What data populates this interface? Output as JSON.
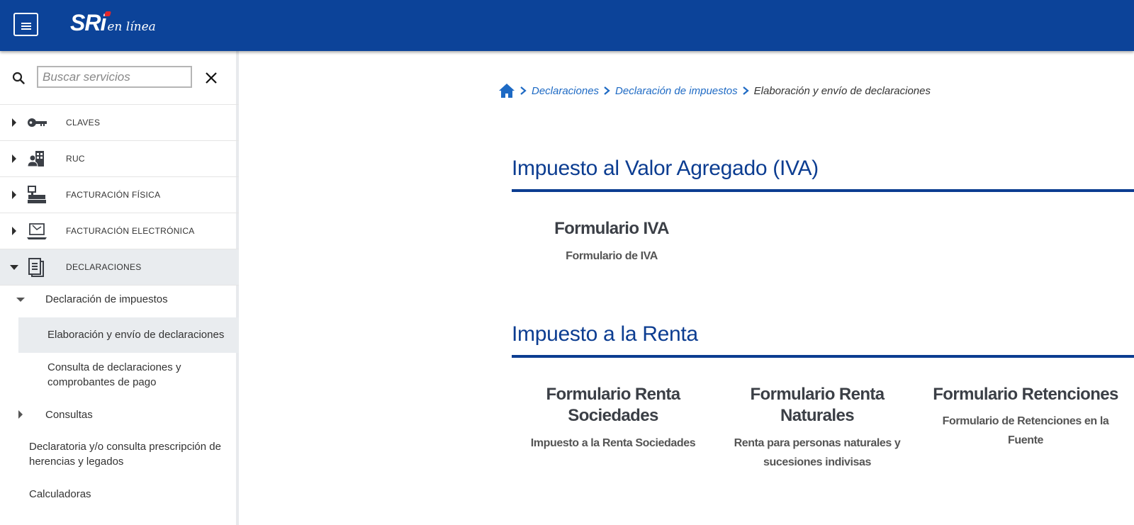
{
  "header": {
    "logo_main": "SRi",
    "logo_sub": "en línea"
  },
  "sidebar": {
    "search_placeholder": "Buscar servicios",
    "items": [
      {
        "label": "CLAVES",
        "icon": "key-icon"
      },
      {
        "label": "RUC",
        "icon": "building-user-icon"
      },
      {
        "label": "FACTURACIÓN FÍSICA",
        "icon": "cash-register-icon"
      },
      {
        "label": "FACTURACIÓN ELECTRÓNICA",
        "icon": "laptop-icon"
      },
      {
        "label": "DECLARACIONES",
        "icon": "document-icon"
      }
    ],
    "sub": {
      "declaracion_impuestos": "Declaración de impuestos",
      "elaboracion": "Elaboración y envío de declaraciones",
      "consulta_line1": "Consulta de declaraciones y",
      "consulta_line2": "comprobantes de pago",
      "consultas": "Consultas",
      "declaratoria_line1": "Declaratoria y/o consulta prescripción de",
      "declaratoria_line2": "herencias y legados",
      "calculadoras": "Calculadoras"
    }
  },
  "breadcrumb": {
    "items": [
      "Declaraciones",
      "Declaración de impuestos"
    ],
    "current": "Elaboración y envío de declaraciones"
  },
  "sections": {
    "iva": {
      "title": "Impuesto al Valor Agregado (IVA)",
      "card": {
        "title": "Formulario IVA",
        "desc": "Formulario de IVA"
      }
    },
    "renta": {
      "title": "Impuesto a la Renta",
      "cards": [
        {
          "title_line1": "Formulario Renta",
          "title_line2": "Sociedades",
          "desc_line1": "Impuesto a la Renta Sociedades",
          "desc_line2": ""
        },
        {
          "title_line1": "Formulario Renta",
          "title_line2": "Naturales",
          "desc_line1": "Renta para personas naturales y",
          "desc_line2": "sucesiones indivisas"
        },
        {
          "title_line1": "Formulario Retenciones",
          "title_line2": "",
          "desc_line1": "Formulario de Retenciones en la",
          "desc_line2": "Fuente"
        }
      ]
    }
  },
  "colors": {
    "brand_blue": "#0c4399",
    "title_blue": "#0c3d91",
    "link_blue": "#1e6ac4",
    "logo_red": "#e3262b"
  }
}
